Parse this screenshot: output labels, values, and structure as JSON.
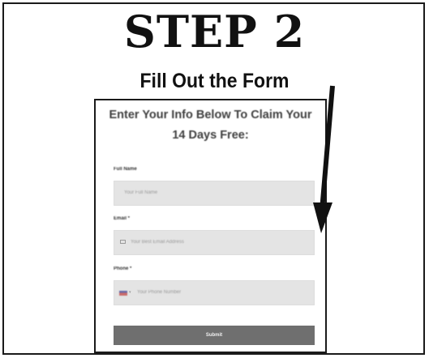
{
  "step": {
    "title": "STEP 2",
    "subtitle": "Fill Out the Form"
  },
  "form": {
    "heading_line1": "Enter Your Info Below To Claim Your",
    "heading_line2": "14 Days Free:",
    "fields": [
      {
        "label": "Full Name",
        "placeholder": "Your Full Name"
      },
      {
        "label": "Email *",
        "placeholder": "Your Best Email Address"
      },
      {
        "label": "Phone *",
        "placeholder": "Your Phone Number"
      }
    ],
    "submit_label": "Submit"
  },
  "colors": {
    "input_bg": "#e4e4e4",
    "button_bg": "#6f6f6f",
    "border": "#1a1a1a"
  }
}
